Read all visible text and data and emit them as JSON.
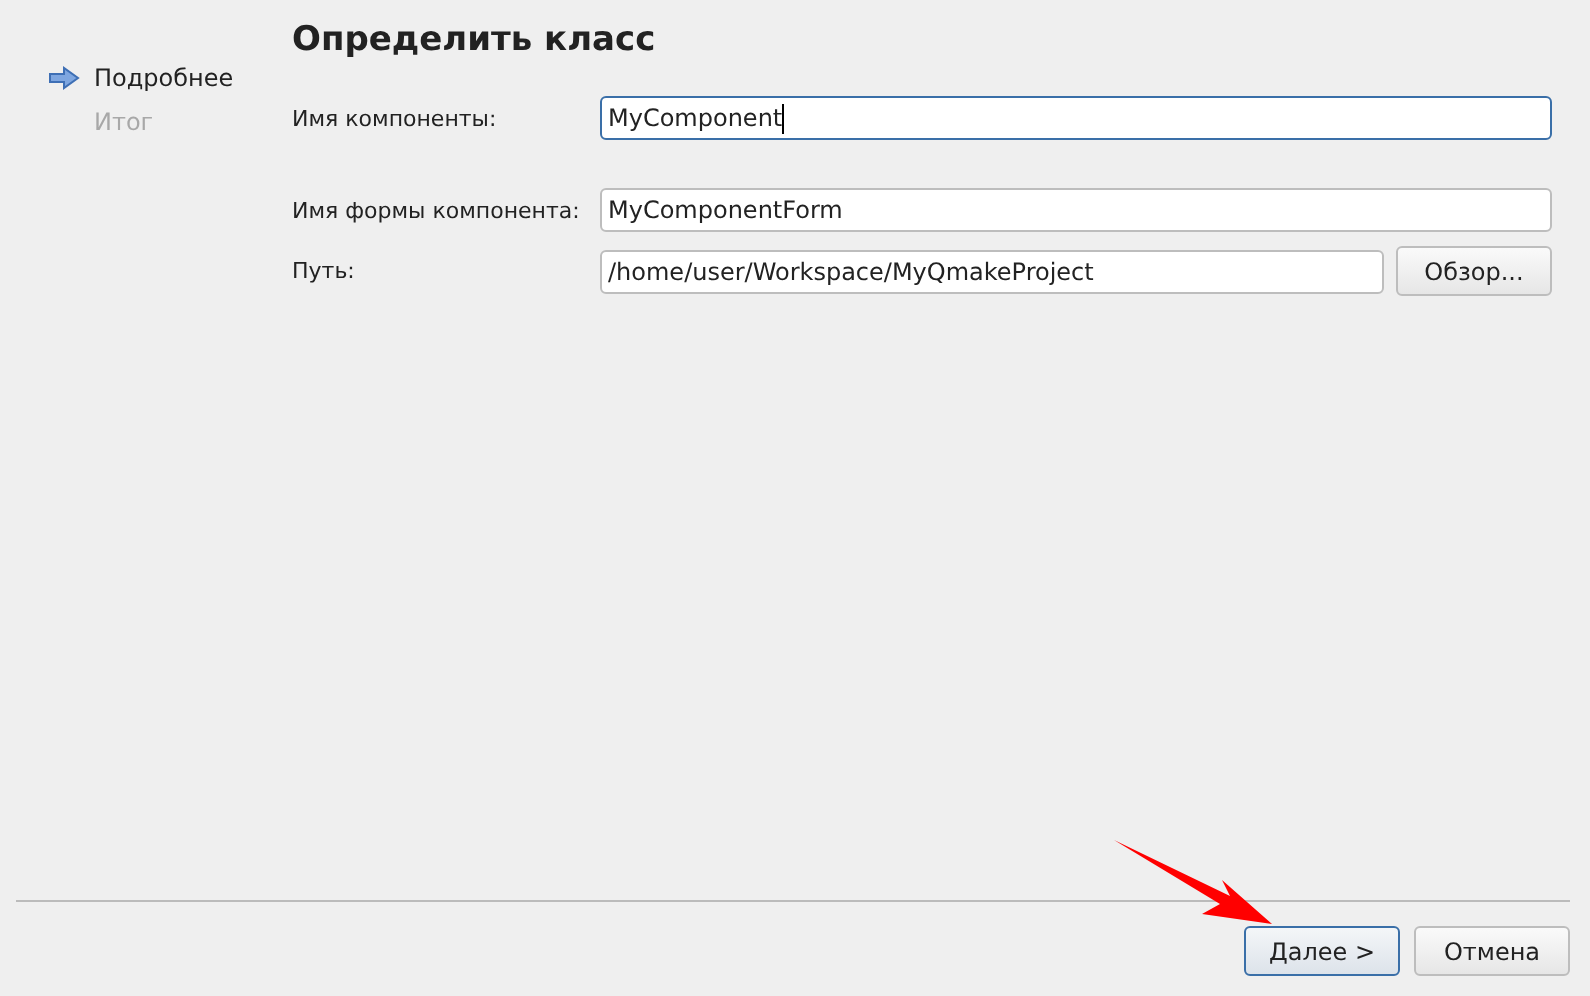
{
  "steps": [
    {
      "label": "Подробнее",
      "selected": true
    },
    {
      "label": "Итог",
      "selected": false
    }
  ],
  "title": "Определить класс",
  "fields": [
    {
      "label": "Имя компоненты:",
      "value": "MyComponent",
      "focused": true
    },
    {
      "label": "Имя формы компонента:",
      "value": "MyComponentForm",
      "focused": false
    },
    {
      "label": "Путь:",
      "value": "/home/user/Workspace/MyQmakeProject",
      "focused": false,
      "button": "Обзор..."
    }
  ],
  "buttons": [
    {
      "label": "Далее >",
      "default": true
    },
    {
      "label": "Отмена",
      "default": false
    }
  ]
}
